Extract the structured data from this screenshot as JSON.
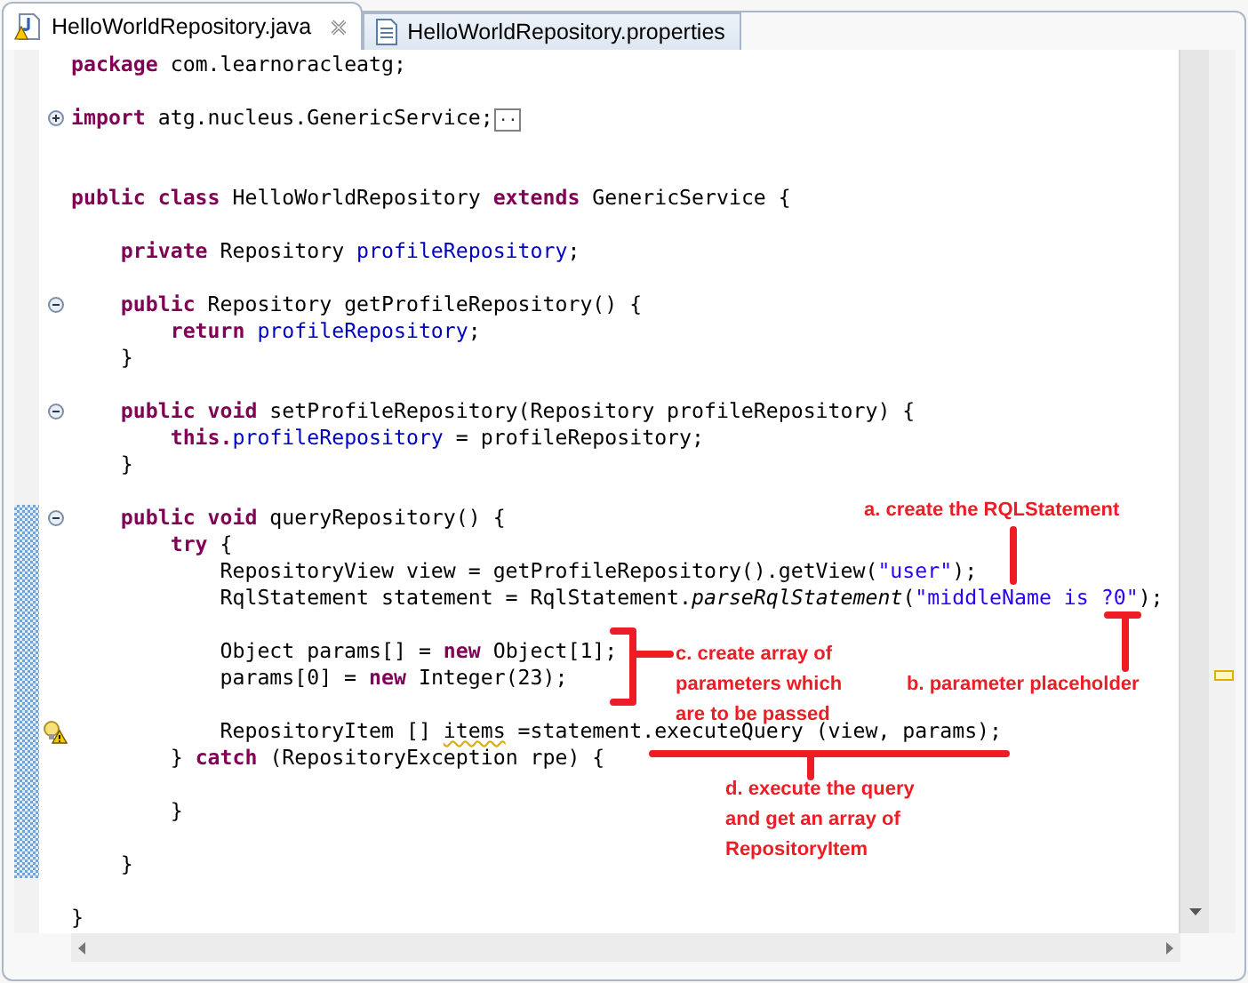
{
  "tabs": [
    {
      "label": "HelloWorldRepository.java",
      "selected": true
    },
    {
      "label": "HelloWorldRepository.properties",
      "selected": false
    }
  ],
  "lines": [
    {
      "changed": false,
      "warning": false,
      "tokens": [
        {
          "kind": "keyword",
          "text": "package"
        },
        {
          "kind": "plain",
          "text": " com.learnoracleatg;"
        }
      ]
    },
    {
      "changed": false,
      "warning": false
    },
    {
      "changed": false,
      "warning": false,
      "fold": {
        "expanded": false
      },
      "tokens": [
        {
          "kind": "keyword",
          "text": "import"
        },
        {
          "kind": "plain",
          "text": " atg.nucleus.GenericService;"
        },
        {
          "kind": "folded",
          "text": ".."
        }
      ]
    },
    {
      "changed": false,
      "warning": false
    },
    {
      "changed": false,
      "warning": false
    },
    {
      "changed": false,
      "warning": false,
      "tokens": [
        {
          "kind": "keyword",
          "text": "public class"
        },
        {
          "kind": "plain",
          "text": " HelloWorldRepository "
        },
        {
          "kind": "keyword",
          "text": "extends"
        },
        {
          "kind": "plain",
          "text": " GenericService {"
        }
      ]
    },
    {
      "changed": false,
      "warning": false
    },
    {
      "changed": false,
      "warning": false,
      "tokens": [
        {
          "kind": "keyword",
          "text": "    private"
        },
        {
          "kind": "plain",
          "text": " Repository "
        },
        {
          "kind": "field",
          "text": "profileRepository"
        },
        {
          "kind": "plain",
          "text": ";"
        }
      ]
    },
    {
      "changed": false,
      "warning": false
    },
    {
      "changed": false,
      "warning": false,
      "fold": {
        "expanded": true
      },
      "tokens": [
        {
          "kind": "keyword",
          "text": "    public"
        },
        {
          "kind": "plain",
          "text": " Repository getProfileRepository() {"
        }
      ]
    },
    {
      "changed": false,
      "warning": false,
      "tokens": [
        {
          "kind": "keyword",
          "text": "        return "
        },
        {
          "kind": "field",
          "text": "profileRepository"
        },
        {
          "kind": "plain",
          "text": ";"
        }
      ]
    },
    {
      "changed": false,
      "warning": false,
      "tokens": [
        {
          "kind": "plain",
          "text": "    }"
        }
      ]
    },
    {
      "changed": false,
      "warning": false
    },
    {
      "changed": false,
      "warning": false,
      "fold": {
        "expanded": true
      },
      "tokens": [
        {
          "kind": "keyword",
          "text": "    public void"
        },
        {
          "kind": "plain",
          "text": " setProfileRepository(Repository profileRepository) {"
        }
      ]
    },
    {
      "changed": false,
      "warning": false,
      "tokens": [
        {
          "kind": "keyword",
          "text": "        this."
        },
        {
          "kind": "field",
          "text": "profileRepository"
        },
        {
          "kind": "plain",
          "text": " = profileRepository;"
        }
      ]
    },
    {
      "changed": false,
      "warning": false,
      "tokens": [
        {
          "kind": "plain",
          "text": "    }"
        }
      ]
    },
    {
      "changed": false,
      "warning": false
    },
    {
      "changed": true,
      "warning": false,
      "fold": {
        "expanded": true
      },
      "tokens": [
        {
          "kind": "keyword",
          "text": "    public void"
        },
        {
          "kind": "plain",
          "text": " queryRepository() {"
        }
      ]
    },
    {
      "changed": true,
      "warning": false,
      "tokens": [
        {
          "kind": "keyword",
          "text": "        try"
        },
        {
          "kind": "plain",
          "text": " {"
        }
      ]
    },
    {
      "changed": true,
      "warning": false,
      "tokens": [
        {
          "kind": "plain",
          "text": "            RepositoryView view = getProfileRepository().getView("
        },
        {
          "kind": "string",
          "text": "\"user\""
        },
        {
          "kind": "plain",
          "text": ");"
        }
      ]
    },
    {
      "changed": true,
      "warning": false,
      "tokens": [
        {
          "kind": "plain",
          "text": "            RqlStatement statement = RqlStatement."
        },
        {
          "kind": "static",
          "text": "parseRqlStatement"
        },
        {
          "kind": "plain",
          "text": "("
        },
        {
          "kind": "string",
          "text": "\"middleName is ?0\""
        },
        {
          "kind": "plain",
          "text": ");"
        }
      ]
    },
    {
      "changed": true,
      "warning": false
    },
    {
      "changed": true,
      "warning": false,
      "tokens": [
        {
          "kind": "plain",
          "text": "            Object params[] = "
        },
        {
          "kind": "keyword",
          "text": "new"
        },
        {
          "kind": "plain",
          "text": " Object[1];"
        }
      ]
    },
    {
      "changed": true,
      "warning": false,
      "tokens": [
        {
          "kind": "plain",
          "text": "            params[0] = "
        },
        {
          "kind": "keyword",
          "text": "new"
        },
        {
          "kind": "plain",
          "text": " Integer(23);"
        }
      ]
    },
    {
      "changed": true,
      "warning": false
    },
    {
      "changed": true,
      "warning": true,
      "tokens": [
        {
          "kind": "plain",
          "text": "            RepositoryItem [] "
        },
        {
          "kind": "warning",
          "text": "items"
        },
        {
          "kind": "plain",
          "text": " =statement.executeQuery (view, params);"
        }
      ]
    },
    {
      "changed": true,
      "warning": false,
      "tokens": [
        {
          "kind": "plain",
          "text": "        } "
        },
        {
          "kind": "keyword",
          "text": "catch"
        },
        {
          "kind": "plain",
          "text": " (RepositoryException rpe) {"
        }
      ]
    },
    {
      "changed": true,
      "warning": false
    },
    {
      "changed": true,
      "warning": false,
      "tokens": [
        {
          "kind": "plain",
          "text": "        }"
        }
      ]
    },
    {
      "changed": true,
      "warning": false
    },
    {
      "changed": true,
      "warning": false,
      "tokens": [
        {
          "kind": "plain",
          "text": "    }"
        }
      ]
    },
    {
      "changed": false,
      "warning": false
    },
    {
      "changed": false,
      "warning": false,
      "tokens": [
        {
          "kind": "plain",
          "text": "}"
        }
      ]
    }
  ],
  "annotations": [
    {
      "lines": [
        "a. create the RQLStatement"
      ]
    },
    {
      "lines": [
        "c. create array of",
        "parameters which",
        "are to be passed"
      ]
    },
    {
      "lines": [
        "b. parameter placeholder"
      ]
    },
    {
      "lines": [
        "d. execute the query",
        "and get an array of",
        "RepositoryItem"
      ]
    }
  ]
}
